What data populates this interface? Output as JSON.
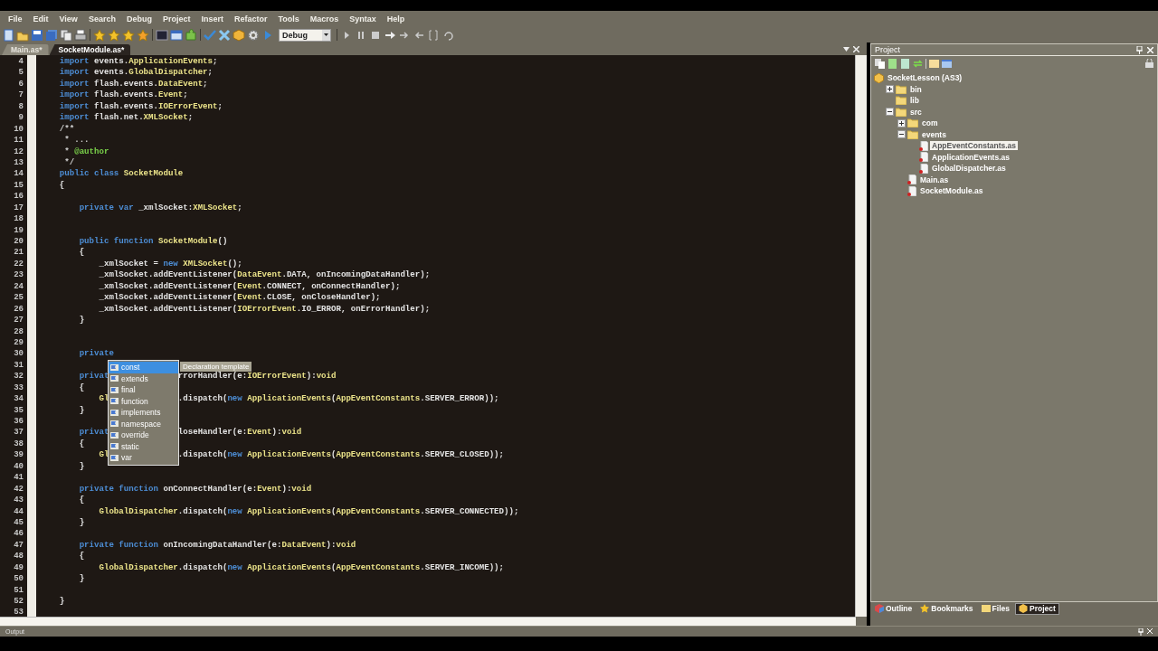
{
  "menu": [
    "File",
    "Edit",
    "View",
    "Search",
    "Debug",
    "Project",
    "Insert",
    "Refactor",
    "Tools",
    "Macros",
    "Syntax",
    "Help"
  ],
  "toolbar": {
    "configuration": "Debug"
  },
  "tabs": [
    {
      "label": "Main.as*",
      "selected": false
    },
    {
      "label": "SocketModule.as*",
      "selected": true
    }
  ],
  "editor": {
    "lines": [
      {
        "number": "4",
        "segments": [
          {
            "kind": "keyword",
            "text": "    import"
          },
          {
            "kind": "plain",
            "text": " events."
          },
          {
            "kind": "type",
            "text": "ApplicationEvents"
          },
          {
            "kind": "plain",
            "text": ";"
          }
        ]
      },
      {
        "number": "5",
        "segments": [
          {
            "kind": "keyword",
            "text": "    import"
          },
          {
            "kind": "plain",
            "text": " events."
          },
          {
            "kind": "type",
            "text": "GlobalDispatcher"
          },
          {
            "kind": "plain",
            "text": ";"
          }
        ]
      },
      {
        "number": "6",
        "segments": [
          {
            "kind": "keyword",
            "text": "    import"
          },
          {
            "kind": "plain",
            "text": " flash.events."
          },
          {
            "kind": "type",
            "text": "DataEvent"
          },
          {
            "kind": "plain",
            "text": ";"
          }
        ]
      },
      {
        "number": "7",
        "segments": [
          {
            "kind": "keyword",
            "text": "    import"
          },
          {
            "kind": "plain",
            "text": " flash.events."
          },
          {
            "kind": "type",
            "text": "Event"
          },
          {
            "kind": "plain",
            "text": ";"
          }
        ]
      },
      {
        "number": "8",
        "segments": [
          {
            "kind": "keyword",
            "text": "    import"
          },
          {
            "kind": "plain",
            "text": " flash.events."
          },
          {
            "kind": "type",
            "text": "IOErrorEvent"
          },
          {
            "kind": "plain",
            "text": ";"
          }
        ]
      },
      {
        "number": "9",
        "segments": [
          {
            "kind": "keyword",
            "text": "    import"
          },
          {
            "kind": "plain",
            "text": " flash.net."
          },
          {
            "kind": "type",
            "text": "XMLSocket"
          },
          {
            "kind": "plain",
            "text": ";"
          }
        ]
      },
      {
        "number": "10",
        "segments": [
          {
            "kind": "comment",
            "text": "    /**"
          }
        ]
      },
      {
        "number": "11",
        "segments": [
          {
            "kind": "comment",
            "text": "     * ..."
          }
        ]
      },
      {
        "number": "12",
        "segments": [
          {
            "kind": "comment",
            "text": "     * "
          },
          {
            "kind": "tag",
            "text": "@author"
          }
        ]
      },
      {
        "number": "13",
        "segments": [
          {
            "kind": "comment",
            "text": "     */"
          }
        ]
      },
      {
        "number": "14",
        "segments": [
          {
            "kind": "keyword",
            "text": "    public class "
          },
          {
            "kind": "type",
            "text": "SocketModule"
          }
        ]
      },
      {
        "number": "15",
        "segments": [
          {
            "kind": "plain",
            "text": "    {"
          }
        ]
      },
      {
        "number": "16"
      },
      {
        "number": "17",
        "segments": [
          {
            "kind": "keyword",
            "text": "        private var "
          },
          {
            "kind": "plain",
            "text": "_xmlSocket:"
          },
          {
            "kind": "type",
            "text": "XMLSocket"
          },
          {
            "kind": "plain",
            "text": ";"
          }
        ]
      },
      {
        "number": "18"
      },
      {
        "number": "19"
      },
      {
        "number": "20",
        "segments": [
          {
            "kind": "keyword",
            "text": "        public function "
          },
          {
            "kind": "type",
            "text": "SocketModule"
          },
          {
            "kind": "plain",
            "text": "()"
          }
        ]
      },
      {
        "number": "21",
        "segments": [
          {
            "kind": "plain",
            "text": "        {"
          }
        ]
      },
      {
        "number": "22",
        "segments": [
          {
            "kind": "plain",
            "text": "            _xmlSocket = "
          },
          {
            "kind": "keyword",
            "text": "new "
          },
          {
            "kind": "type",
            "text": "XMLSocket"
          },
          {
            "kind": "plain",
            "text": "();"
          }
        ]
      },
      {
        "number": "23",
        "segments": [
          {
            "kind": "plain",
            "text": "            _xmlSocket.addEventListener("
          },
          {
            "kind": "type",
            "text": "DataEvent"
          },
          {
            "kind": "plain",
            "text": ".DATA, onIncomingDataHandler);"
          }
        ]
      },
      {
        "number": "24",
        "segments": [
          {
            "kind": "plain",
            "text": "            _xmlSocket.addEventListener("
          },
          {
            "kind": "type",
            "text": "Event"
          },
          {
            "kind": "plain",
            "text": ".CONNECT, onConnectHandler);"
          }
        ]
      },
      {
        "number": "25",
        "segments": [
          {
            "kind": "plain",
            "text": "            _xmlSocket.addEventListener("
          },
          {
            "kind": "type",
            "text": "Event"
          },
          {
            "kind": "plain",
            "text": ".CLOSE, onCloseHandler);"
          }
        ]
      },
      {
        "number": "26",
        "segments": [
          {
            "kind": "plain",
            "text": "            _xmlSocket.addEventListener("
          },
          {
            "kind": "type",
            "text": "IOErrorEvent"
          },
          {
            "kind": "plain",
            "text": ".IO_ERROR, onErrorHandler);"
          }
        ]
      },
      {
        "number": "27",
        "segments": [
          {
            "kind": "plain",
            "text": "        }"
          }
        ]
      },
      {
        "number": "28"
      },
      {
        "number": "29"
      },
      {
        "number": "30",
        "segments": [
          {
            "kind": "keyword",
            "text": "        private"
          }
        ]
      },
      {
        "number": "31"
      },
      {
        "number": "32",
        "segments": [
          {
            "kind": "keyword",
            "text": "        privat"
          }
        ],
        "after_popup": [
          {
            "kind": "plain",
            "text": "rrorHandler(e:"
          },
          {
            "kind": "type",
            "text": "IOErrorEvent"
          },
          {
            "kind": "plain",
            "text": "):"
          },
          {
            "kind": "type",
            "text": "void"
          }
        ]
      },
      {
        "number": "33",
        "segments": [
          {
            "kind": "plain",
            "text": "        {"
          }
        ]
      },
      {
        "number": "34",
        "segments": [
          {
            "kind": "type",
            "text": "            Gl"
          }
        ],
        "after_popup": [
          {
            "kind": "plain",
            "text": ".dispatch("
          },
          {
            "kind": "keyword",
            "text": "new "
          },
          {
            "kind": "type",
            "text": "ApplicationEvents"
          },
          {
            "kind": "plain",
            "text": "("
          },
          {
            "kind": "type",
            "text": "AppEventConstants"
          },
          {
            "kind": "plain",
            "text": ".SERVER_ERROR));"
          }
        ]
      },
      {
        "number": "35",
        "segments": [
          {
            "kind": "plain",
            "text": "        }"
          }
        ]
      },
      {
        "number": "36"
      },
      {
        "number": "37",
        "segments": [
          {
            "kind": "keyword",
            "text": "        privat"
          }
        ],
        "after_popup": [
          {
            "kind": "plain",
            "text": "loseHandler(e:"
          },
          {
            "kind": "type",
            "text": "Event"
          },
          {
            "kind": "plain",
            "text": "):"
          },
          {
            "kind": "type",
            "text": "void"
          }
        ]
      },
      {
        "number": "38",
        "segments": [
          {
            "kind": "plain",
            "text": "        {"
          }
        ]
      },
      {
        "number": "39",
        "segments": [
          {
            "kind": "type",
            "text": "            Gl"
          }
        ],
        "after_popup": [
          {
            "kind": "plain",
            "text": ".dispatch("
          },
          {
            "kind": "keyword",
            "text": "new "
          },
          {
            "kind": "type",
            "text": "ApplicationEvents"
          },
          {
            "kind": "plain",
            "text": "("
          },
          {
            "kind": "type",
            "text": "AppEventConstants"
          },
          {
            "kind": "plain",
            "text": ".SERVER_CLOSED));"
          }
        ]
      },
      {
        "number": "40",
        "segments": [
          {
            "kind": "plain",
            "text": "        }"
          }
        ]
      },
      {
        "number": "41"
      },
      {
        "number": "42",
        "segments": [
          {
            "kind": "keyword",
            "text": "        private function "
          },
          {
            "kind": "plain",
            "text": "onConnectHandler(e:"
          },
          {
            "kind": "type",
            "text": "Event"
          },
          {
            "kind": "plain",
            "text": "):"
          },
          {
            "kind": "type",
            "text": "void"
          }
        ]
      },
      {
        "number": "43",
        "segments": [
          {
            "kind": "plain",
            "text": "        {"
          }
        ]
      },
      {
        "number": "44",
        "segments": [
          {
            "kind": "type",
            "text": "            GlobalDispatcher"
          },
          {
            "kind": "plain",
            "text": ".dispatch("
          },
          {
            "kind": "keyword",
            "text": "new "
          },
          {
            "kind": "type",
            "text": "ApplicationEvents"
          },
          {
            "kind": "plain",
            "text": "("
          },
          {
            "kind": "type",
            "text": "AppEventConstants"
          },
          {
            "kind": "plain",
            "text": ".SERVER_CONNECTED));"
          }
        ]
      },
      {
        "number": "45",
        "segments": [
          {
            "kind": "plain",
            "text": "        }"
          }
        ]
      },
      {
        "number": "46"
      },
      {
        "number": "47",
        "segments": [
          {
            "kind": "keyword",
            "text": "        private function "
          },
          {
            "kind": "plain",
            "text": "onIncomingDataHandler(e:"
          },
          {
            "kind": "type",
            "text": "DataEvent"
          },
          {
            "kind": "plain",
            "text": "):"
          },
          {
            "kind": "type",
            "text": "void"
          }
        ]
      },
      {
        "number": "48",
        "segments": [
          {
            "kind": "plain",
            "text": "        {"
          }
        ]
      },
      {
        "number": "49",
        "segments": [
          {
            "kind": "type",
            "text": "            GlobalDispatcher"
          },
          {
            "kind": "plain",
            "text": ".dispatch("
          },
          {
            "kind": "keyword",
            "text": "new "
          },
          {
            "kind": "type",
            "text": "ApplicationEvents"
          },
          {
            "kind": "plain",
            "text": "("
          },
          {
            "kind": "type",
            "text": "AppEventConstants"
          },
          {
            "kind": "plain",
            "text": ".SERVER_INCOME));"
          }
        ]
      },
      {
        "number": "50",
        "segments": [
          {
            "kind": "plain",
            "text": "        }"
          }
        ]
      },
      {
        "number": "51"
      },
      {
        "number": "52",
        "segments": [
          {
            "kind": "plain",
            "text": "    }"
          }
        ]
      },
      {
        "number": "53"
      }
    ],
    "completion": {
      "items": [
        {
          "label": "const",
          "selected": true
        },
        {
          "label": "extends",
          "selected": false
        },
        {
          "label": "final",
          "selected": false
        },
        {
          "label": "function",
          "selected": false
        },
        {
          "label": "implements",
          "selected": false
        },
        {
          "label": "namespace",
          "selected": false
        },
        {
          "label": "override",
          "selected": false
        },
        {
          "label": "static",
          "selected": false
        },
        {
          "label": "var",
          "selected": false
        }
      ],
      "tooltip": "Declaration template"
    }
  },
  "project": {
    "title": "Project",
    "tree": [
      {
        "label": "SocketLesson (AS3)",
        "kind": "project",
        "selected": false,
        "children": [
          {
            "label": "bin",
            "kind": "folder",
            "expanded": false,
            "selected": false
          },
          {
            "label": "lib",
            "kind": "folder",
            "selected": false
          },
          {
            "label": "src",
            "kind": "folder",
            "expanded": true,
            "selected": false,
            "children": [
              {
                "label": "com",
                "kind": "folder",
                "expanded": false,
                "selected": false
              },
              {
                "label": "events",
                "kind": "folder",
                "expanded": true,
                "selected": false,
                "children": [
                  {
                    "label": "AppEventConstants.as",
                    "kind": "file",
                    "selected": true
                  },
                  {
                    "label": "ApplicationEvents.as",
                    "kind": "file",
                    "selected": false
                  },
                  {
                    "label": "GlobalDispatcher.as",
                    "kind": "file",
                    "selected": false
                  }
                ]
              },
              {
                "label": "Main.as",
                "kind": "file",
                "selected": false
              },
              {
                "label": "SocketModule.as",
                "kind": "file",
                "selected": false
              }
            ]
          }
        ]
      }
    ],
    "panel_tabs": [
      {
        "label": "Outline",
        "selected": false
      },
      {
        "label": "Bookmarks",
        "selected": false
      },
      {
        "label": "Files",
        "selected": false
      },
      {
        "label": "Project",
        "selected": true
      }
    ]
  },
  "output": {
    "title": "Output"
  }
}
